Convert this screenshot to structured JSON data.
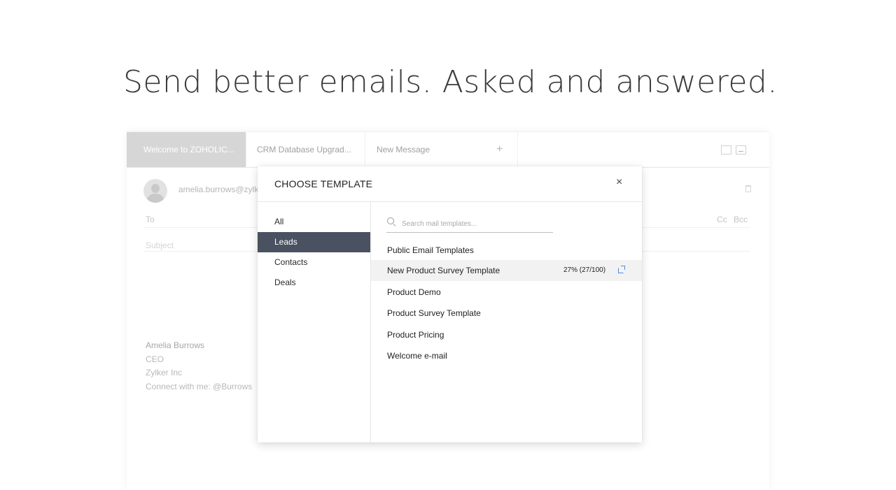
{
  "headline": "Send better emails. Asked and answered.",
  "compose": {
    "tabs": [
      {
        "label": "Welcome to ZOHOLIC..."
      },
      {
        "label": "CRM Database Upgrad..."
      },
      {
        "label": "New Message"
      }
    ],
    "add_tab": "+",
    "from_email": "amelia.burrows@zylker.com",
    "to_label": "To",
    "subject_placeholder": "Subject",
    "cc_label": "Cc",
    "bcc_label": "Bcc",
    "signature": {
      "name": "Amelia Burrows",
      "title": "CEO",
      "company": "Zylker Inc",
      "connect": "Connect with me: @Burrows"
    }
  },
  "modal": {
    "title": "CHOOSE TEMPLATE",
    "close": "×",
    "categories": [
      {
        "label": "All"
      },
      {
        "label": "Leads"
      },
      {
        "label": "Contacts"
      },
      {
        "label": "Deals"
      }
    ],
    "active_category": "Leads",
    "search_placeholder": "Search mail templates...",
    "templates": [
      {
        "name": "Public Email Templates"
      },
      {
        "name": "New Product Survey Template",
        "stat": "27% (27/100)"
      },
      {
        "name": "Product Demo"
      },
      {
        "name": "Product Survey Template"
      },
      {
        "name": "Product Pricing"
      },
      {
        "name": "Welcome e-mail"
      }
    ]
  },
  "colors": {
    "active_category_bg": "#4a5161",
    "active_tab_bg": "#d6d6d6",
    "link_icon": "#4a8fe0"
  }
}
